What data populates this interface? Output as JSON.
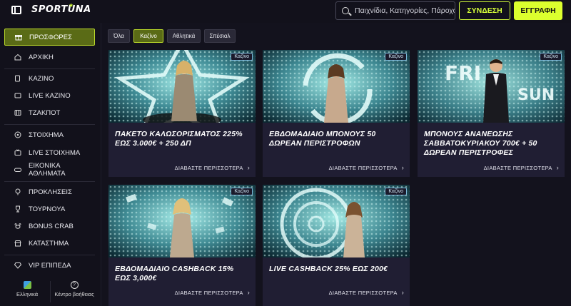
{
  "header": {
    "logo": "SPORTUNA",
    "search_placeholder": "Παιχνίδια, Κατηγορίες, Πάροχοι",
    "login_label": "ΣΥΝΔΕΣΗ",
    "register_label": "ΕΓΓΡΑΦΗ"
  },
  "sidebar": {
    "items": [
      {
        "label": "ΠΡΟΣΦΟΡΕΣ",
        "icon": "gift-icon"
      },
      {
        "label": "ΑΡΧΙΚΗ",
        "icon": "home-icon"
      },
      {
        "label": "ΚΑΖΙΝΟ",
        "icon": "cards-icon"
      },
      {
        "label": "LIVE ΚΑΖΙΝΟ",
        "icon": "live-casino-icon"
      },
      {
        "label": "ΤΖΑΚΠΟΤ",
        "icon": "jackpot-icon"
      },
      {
        "label": "ΣΤΟΙΧΗΜΑ",
        "icon": "soccer-ball-icon"
      },
      {
        "label": "LIVE ΣΤΟΙΧΗΜΑ",
        "icon": "live-tv-icon"
      },
      {
        "label": "ΕΙΚΟΝΙΚΑ ΑΘΛΗΜΑΤΑ",
        "icon": "gamepad-icon"
      },
      {
        "label": "ΠΡΟΚΛΗΣΕΙΣ",
        "icon": "challenge-icon"
      },
      {
        "label": "ΤΟΥΡΝΟΥΑ",
        "icon": "trophy-icon"
      },
      {
        "label": "BONUS CRAB",
        "icon": "crab-icon"
      },
      {
        "label": "ΚΑΤΑΣΤΗΜΑ",
        "icon": "shop-icon"
      },
      {
        "label": "VIP ΕΠΙΠΕΔΑ",
        "icon": "diamond-icon"
      }
    ],
    "footer": {
      "language": "Ελληνικά",
      "help": "Κέντρο βοήθειας"
    }
  },
  "filters": [
    {
      "label": "Όλα",
      "active": false
    },
    {
      "label": "Καζίνο",
      "active": true
    },
    {
      "label": "Αθλητικά",
      "active": false
    },
    {
      "label": "Σπέσιαλ",
      "active": false
    }
  ],
  "cards": [
    {
      "tag": "Καζίνο",
      "title": "ΠΑΚΕΤΟ ΚΑΛΩΣΟΡΙΣΜΑΤΟΣ 225% ΕΩΣ 3.000€ + 250 ΔΠ",
      "more": "ΔΙΑΒΑΣΤΕ ΠΕΡΙΣΣΟΤΕΡΑ"
    },
    {
      "tag": "Καζίνο",
      "title": "ΕΒΔΟΜΑΔΙΑΙΟ ΜΠΟΝΟΥΣ 50 ΔΩΡΕΑΝ ΠΕΡΙΣΤΡΟΦΩΝ",
      "more": "ΔΙΑΒΑΣΤΕ ΠΕΡΙΣΣΟΤΕΡΑ"
    },
    {
      "tag": "Καζίνο",
      "title": "ΜΠΟΝΟΥΣ ΑΝΑΝΕΩΣΗΣ ΣΑΒΒΑΤΟΚΥΡΙΑΚΟΥ 700€ + 50 ΔΩΡΕΑΝ ΠΕΡΙΣΤΡΟΦΕΣ",
      "more": "ΔΙΑΒΑΣΤΕ ΠΕΡΙΣΣΟΤΕΡΑ",
      "image_text": [
        "FRI",
        "SUN"
      ]
    },
    {
      "tag": "Καζίνο",
      "title": "ΕΒΔΟΜΑΔΙΑΙΟ CASHBACK 15% ΕΩΣ 3,000€",
      "more": "ΔΙΑΒΑΣΤΕ ΠΕΡΙΣΣΟΤΕΡΑ"
    },
    {
      "tag": "Καζίνο",
      "title": "LIVE CASHBACK 25% ΕΩΣ 200€",
      "more": "ΔΙΑΒΑΣΤΕ ΠΕΡΙΣΣΟΤΕΡΑ"
    }
  ],
  "colors": {
    "accent": "#dcff2e",
    "background": "#13121d",
    "card": "#201e33",
    "active_chip": "#5a6b16"
  }
}
